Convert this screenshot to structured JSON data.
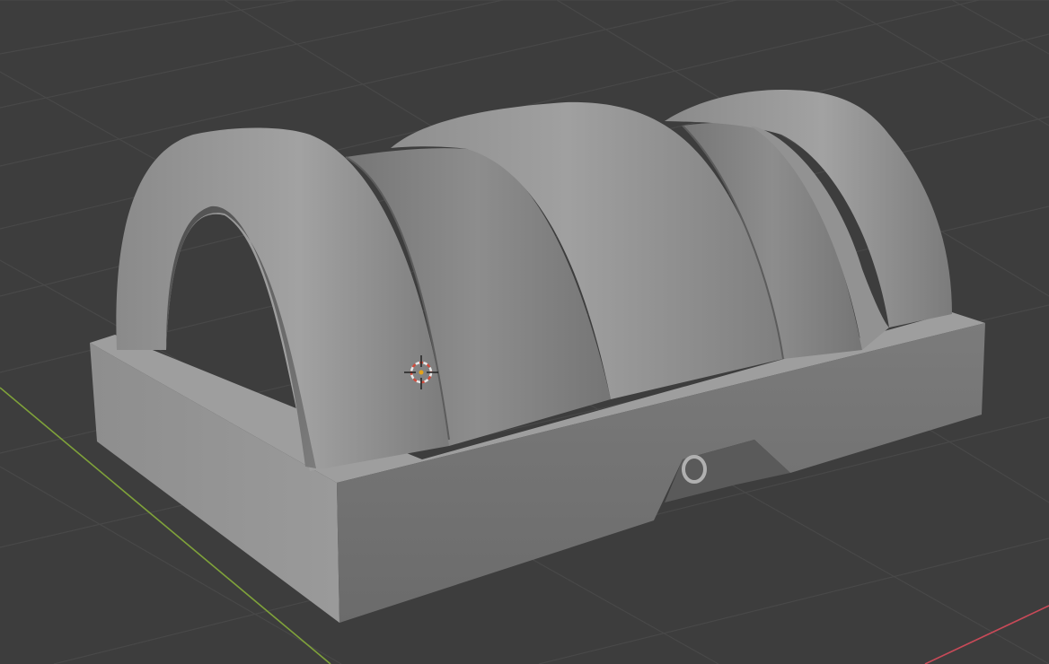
{
  "app": {
    "name": "",
    "view": "3D Viewport"
  },
  "viewport": {
    "background": "#3d3d3d",
    "grid_color": "#4a4a4a",
    "x_axis_color": "#c84a58",
    "y_axis_color": "#7fa23a",
    "grid_visible": true,
    "shading": "solid"
  },
  "scene_object": {
    "description_visible": false,
    "material_color": "#8c8c8c",
    "selected": false
  },
  "cursor": {
    "icon": "3d-cursor-icon",
    "ring_color_a": "#e8e8e8",
    "ring_color_b": "#d24b3c",
    "center_color": "#e3a21a"
  }
}
